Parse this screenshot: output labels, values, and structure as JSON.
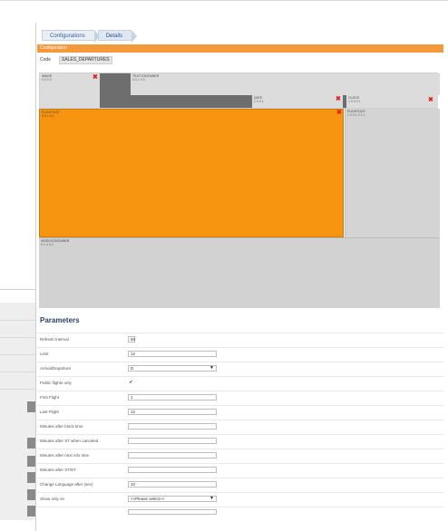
{
  "breadcrumbs": [
    {
      "label": "Configurations"
    },
    {
      "label": "Details"
    }
  ],
  "configuration": {
    "header": "Configuration",
    "code_label": "Code",
    "code_value": "SALES_DEPARTURES"
  },
  "layout_tiles": {
    "image": {
      "name": "IMAGE",
      "info": "0 0 0 0"
    },
    "textcontainer": {
      "name": "TEXTCONTAINER",
      "info": "0 0 1 4 0"
    },
    "date": {
      "name": "DATE",
      "info": "1 0 0 1"
    },
    "clock": {
      "name": "CLOCK",
      "info": "1 0 0 0 1"
    },
    "flightlist_main": {
      "name": "FLIGHTLIST",
      "info": "0 0 1 0 1"
    },
    "flightlist_side": {
      "name": "FLIGHTLIST",
      "info": "1 0 0 1 0 1 1"
    },
    "videocontainer": {
      "name": "VIDEOCONTAINER",
      "info": "0 1 4 0 0"
    }
  },
  "colors": {
    "accent": "#f59a3a",
    "tile_gray": "#d4d4d4",
    "dark_bar": "#6e6e6e",
    "close_red": "#e02020"
  },
  "parameters": {
    "title": "Parameters",
    "refresh_interval": {
      "label": "Refresh Interval",
      "value": "60"
    },
    "limit": {
      "label": "Limit",
      "value": "12"
    },
    "arrival_departure": {
      "label": "Arrival/Departure",
      "value": "D"
    },
    "public_flights_only": {
      "label": "Public flights only",
      "checked": true,
      "mark": "✔"
    },
    "first_flight": {
      "label": "First Flight",
      "value": "1"
    },
    "last_flight": {
      "label": "Last Flight",
      "value": "12"
    },
    "minutes_after_block": {
      "label": "Minutes after block time",
      "value": ""
    },
    "minutes_after_st_canceled": {
      "label": "Minutes after ST when canceled",
      "value": ""
    },
    "minutes_after_next_info": {
      "label": "Minutes after next info time",
      "value": ""
    },
    "minutes_after_st_et": {
      "label": "Minutes after ST/ET",
      "value": ""
    },
    "change_language_after": {
      "label": "Change Language after (sec)",
      "value": "10"
    },
    "show_only_on": {
      "label": "Show only on",
      "value": "<<Please select>>"
    }
  }
}
